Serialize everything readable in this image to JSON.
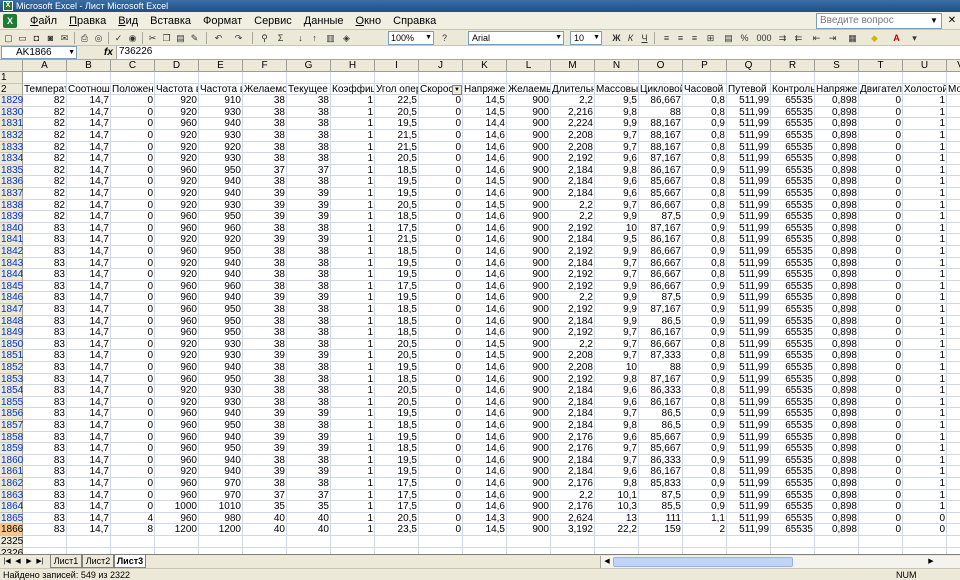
{
  "window": {
    "title": "Microsoft Excel - Лист Microsoft Excel"
  },
  "menu": {
    "items": [
      {
        "u": "Ф",
        "r": "айл"
      },
      {
        "u": "П",
        "r": "равка"
      },
      {
        "u": "В",
        "r": "ид"
      },
      {
        "u": "",
        "r": "Вставка"
      },
      {
        "u": "",
        "r": "Формат"
      },
      {
        "u": "",
        "r": "Сервис"
      },
      {
        "u": "Д",
        "r": "анные"
      },
      {
        "u": "О",
        "r": "кно"
      },
      {
        "u": "",
        "r": "Справка"
      }
    ],
    "help_placeholder": "Введите вопрос"
  },
  "toolbar": {
    "zoom": "100%",
    "font": "Arial",
    "font_size": "10",
    "bold": "Ж",
    "italic": "К",
    "underline": "Ч",
    "percent": "%",
    "thousands": "000"
  },
  "formula": {
    "namebox": "AK1866",
    "fx": "fx",
    "value": "736226"
  },
  "sheet": {
    "columns": [
      "A",
      "B",
      "C",
      "D",
      "E",
      "F",
      "G",
      "H",
      "I",
      "J",
      "K",
      "L",
      "M",
      "N",
      "O",
      "P",
      "Q",
      "R",
      "S",
      "T",
      "U",
      "V"
    ],
    "header_row_labels": [
      "1",
      "2"
    ],
    "headers": [
      "Температ",
      "Соотноше",
      "Положени",
      "Частота в",
      "Частота в",
      "Желаемое",
      "Текущее г",
      "Коэффици",
      "Угол опер",
      "Скорост",
      "Напряжен",
      "Желаемые",
      "Длительнс",
      "Массовый",
      "Цикловой",
      "Часовой р",
      "Путевой р",
      "Контрольн",
      "Напряжен",
      "Двигатель",
      "Холостой з",
      "Мощн"
    ],
    "rows": [
      {
        "n": "1829",
        "v": [
          "82",
          "14,7",
          "0",
          "920",
          "910",
          "38",
          "38",
          "1",
          "22,5",
          "0",
          "14,5",
          "900",
          "2,2",
          "9,5",
          "86,667",
          "0,8",
          "511,99",
          "65535",
          "0,898",
          "0",
          "1",
          ""
        ]
      },
      {
        "n": "1830",
        "v": [
          "82",
          "14,7",
          "0",
          "920",
          "930",
          "38",
          "38",
          "1",
          "20,5",
          "0",
          "14,5",
          "900",
          "2,216",
          "9,8",
          "88",
          "0,8",
          "511,99",
          "65535",
          "0,898",
          "0",
          "1",
          ""
        ]
      },
      {
        "n": "1831",
        "v": [
          "82",
          "14,7",
          "0",
          "960",
          "940",
          "38",
          "38",
          "1",
          "19,5",
          "0",
          "14,4",
          "900",
          "2,224",
          "9,9",
          "88,167",
          "0,9",
          "511,99",
          "65535",
          "0,898",
          "0",
          "1",
          ""
        ]
      },
      {
        "n": "1832",
        "v": [
          "82",
          "14,7",
          "0",
          "920",
          "930",
          "38",
          "38",
          "1",
          "21,5",
          "0",
          "14,6",
          "900",
          "2,208",
          "9,7",
          "88,167",
          "0,8",
          "511,99",
          "65535",
          "0,898",
          "0",
          "1",
          ""
        ]
      },
      {
        "n": "1833",
        "v": [
          "82",
          "14,7",
          "0",
          "920",
          "920",
          "38",
          "38",
          "1",
          "21,5",
          "0",
          "14,6",
          "900",
          "2,208",
          "9,7",
          "88,167",
          "0,8",
          "511,99",
          "65535",
          "0,898",
          "0",
          "1",
          ""
        ]
      },
      {
        "n": "1834",
        "v": [
          "82",
          "14,7",
          "0",
          "920",
          "930",
          "38",
          "38",
          "1",
          "20,5",
          "0",
          "14,6",
          "900",
          "2,192",
          "9,6",
          "87,167",
          "0,8",
          "511,99",
          "65535",
          "0,898",
          "0",
          "1",
          ""
        ]
      },
      {
        "n": "1835",
        "v": [
          "82",
          "14,7",
          "0",
          "960",
          "950",
          "37",
          "37",
          "1",
          "18,5",
          "0",
          "14,6",
          "900",
          "2,184",
          "9,8",
          "86,167",
          "0,9",
          "511,99",
          "65535",
          "0,898",
          "0",
          "1",
          ""
        ]
      },
      {
        "n": "1836",
        "v": [
          "82",
          "14,7",
          "0",
          "920",
          "940",
          "38",
          "38",
          "1",
          "19,5",
          "0",
          "14,5",
          "900",
          "2,184",
          "9,6",
          "85,667",
          "0,8",
          "511,99",
          "65535",
          "0,898",
          "0",
          "1",
          ""
        ]
      },
      {
        "n": "1837",
        "v": [
          "82",
          "14,7",
          "0",
          "920",
          "940",
          "39",
          "39",
          "1",
          "19,5",
          "0",
          "14,6",
          "900",
          "2,184",
          "9,6",
          "85,667",
          "0,8",
          "511,99",
          "65535",
          "0,898",
          "0",
          "1",
          ""
        ]
      },
      {
        "n": "1838",
        "v": [
          "82",
          "14,7",
          "0",
          "920",
          "930",
          "39",
          "39",
          "1",
          "20,5",
          "0",
          "14,5",
          "900",
          "2,2",
          "9,7",
          "86,667",
          "0,8",
          "511,99",
          "65535",
          "0,898",
          "0",
          "1",
          ""
        ]
      },
      {
        "n": "1839",
        "v": [
          "82",
          "14,7",
          "0",
          "960",
          "950",
          "39",
          "39",
          "1",
          "18,5",
          "0",
          "14,6",
          "900",
          "2,2",
          "9,9",
          "87,5",
          "0,9",
          "511,99",
          "65535",
          "0,898",
          "0",
          "1",
          ""
        ]
      },
      {
        "n": "1840",
        "v": [
          "83",
          "14,7",
          "0",
          "960",
          "960",
          "38",
          "38",
          "1",
          "17,5",
          "0",
          "14,6",
          "900",
          "2,192",
          "10",
          "87,167",
          "0,9",
          "511,99",
          "65535",
          "0,898",
          "0",
          "1",
          ""
        ]
      },
      {
        "n": "1841",
        "v": [
          "83",
          "14,7",
          "0",
          "920",
          "920",
          "39",
          "39",
          "1",
          "21,5",
          "0",
          "14,6",
          "900",
          "2,184",
          "9,5",
          "86,167",
          "0,8",
          "511,99",
          "65535",
          "0,898",
          "0",
          "1",
          ""
        ]
      },
      {
        "n": "1842",
        "v": [
          "83",
          "14,7",
          "0",
          "960",
          "950",
          "38",
          "38",
          "1",
          "18,5",
          "0",
          "14,6",
          "900",
          "2,192",
          "9,9",
          "86,667",
          "0,9",
          "511,99",
          "65535",
          "0,898",
          "0",
          "1",
          ""
        ]
      },
      {
        "n": "1843",
        "v": [
          "83",
          "14,7",
          "0",
          "920",
          "940",
          "38",
          "38",
          "1",
          "19,5",
          "0",
          "14,6",
          "900",
          "2,184",
          "9,7",
          "86,667",
          "0,8",
          "511,99",
          "65535",
          "0,898",
          "0",
          "1",
          ""
        ]
      },
      {
        "n": "1844",
        "v": [
          "83",
          "14,7",
          "0",
          "920",
          "940",
          "38",
          "38",
          "1",
          "19,5",
          "0",
          "14,6",
          "900",
          "2,192",
          "9,7",
          "86,667",
          "0,8",
          "511,99",
          "65535",
          "0,898",
          "0",
          "1",
          ""
        ]
      },
      {
        "n": "1845",
        "v": [
          "83",
          "14,7",
          "0",
          "960",
          "960",
          "38",
          "38",
          "1",
          "17,5",
          "0",
          "14,6",
          "900",
          "2,192",
          "9,9",
          "86,667",
          "0,9",
          "511,99",
          "65535",
          "0,898",
          "0",
          "1",
          ""
        ]
      },
      {
        "n": "1846",
        "v": [
          "83",
          "14,7",
          "0",
          "960",
          "940",
          "39",
          "39",
          "1",
          "19,5",
          "0",
          "14,6",
          "900",
          "2,2",
          "9,9",
          "87,5",
          "0,9",
          "511,99",
          "65535",
          "0,898",
          "0",
          "1",
          ""
        ]
      },
      {
        "n": "1847",
        "v": [
          "83",
          "14,7",
          "0",
          "960",
          "950",
          "38",
          "38",
          "1",
          "18,5",
          "0",
          "14,6",
          "900",
          "2,192",
          "9,9",
          "87,167",
          "0,9",
          "511,99",
          "65535",
          "0,898",
          "0",
          "1",
          ""
        ]
      },
      {
        "n": "1848",
        "v": [
          "83",
          "14,7",
          "0",
          "960",
          "950",
          "38",
          "38",
          "1",
          "18,5",
          "0",
          "14,6",
          "900",
          "2,184",
          "9,9",
          "86,5",
          "0,9",
          "511,99",
          "65535",
          "0,898",
          "0",
          "1",
          ""
        ]
      },
      {
        "n": "1849",
        "v": [
          "83",
          "14,7",
          "0",
          "960",
          "950",
          "38",
          "38",
          "1",
          "18,5",
          "0",
          "14,6",
          "900",
          "2,192",
          "9,7",
          "86,167",
          "0,9",
          "511,99",
          "65535",
          "0,898",
          "0",
          "1",
          ""
        ]
      },
      {
        "n": "1850",
        "v": [
          "83",
          "14,7",
          "0",
          "920",
          "930",
          "38",
          "38",
          "1",
          "20,5",
          "0",
          "14,5",
          "900",
          "2,2",
          "9,7",
          "86,667",
          "0,8",
          "511,99",
          "65535",
          "0,898",
          "0",
          "1",
          ""
        ]
      },
      {
        "n": "1851",
        "v": [
          "83",
          "14,7",
          "0",
          "920",
          "930",
          "39",
          "39",
          "1",
          "20,5",
          "0",
          "14,5",
          "900",
          "2,208",
          "9,7",
          "87,333",
          "0,8",
          "511,99",
          "65535",
          "0,898",
          "0",
          "1",
          ""
        ]
      },
      {
        "n": "1852",
        "v": [
          "83",
          "14,7",
          "0",
          "960",
          "940",
          "38",
          "38",
          "1",
          "19,5",
          "0",
          "14,6",
          "900",
          "2,208",
          "10",
          "88",
          "0,9",
          "511,99",
          "65535",
          "0,898",
          "0",
          "1",
          ""
        ]
      },
      {
        "n": "1853",
        "v": [
          "83",
          "14,7",
          "0",
          "960",
          "950",
          "38",
          "38",
          "1",
          "18,5",
          "0",
          "14,6",
          "900",
          "2,192",
          "9,8",
          "87,167",
          "0,9",
          "511,99",
          "65535",
          "0,898",
          "0",
          "1",
          ""
        ]
      },
      {
        "n": "1854",
        "v": [
          "83",
          "14,7",
          "0",
          "920",
          "930",
          "38",
          "38",
          "1",
          "20,5",
          "0",
          "14,6",
          "900",
          "2,184",
          "9,6",
          "86,333",
          "0,8",
          "511,99",
          "65535",
          "0,898",
          "0",
          "1",
          ""
        ]
      },
      {
        "n": "1855",
        "v": [
          "83",
          "14,7",
          "0",
          "920",
          "930",
          "38",
          "38",
          "1",
          "20,5",
          "0",
          "14,6",
          "900",
          "2,184",
          "9,6",
          "86,167",
          "0,8",
          "511,99",
          "65535",
          "0,898",
          "0",
          "1",
          ""
        ]
      },
      {
        "n": "1856",
        "v": [
          "83",
          "14,7",
          "0",
          "960",
          "940",
          "39",
          "39",
          "1",
          "19,5",
          "0",
          "14,6",
          "900",
          "2,184",
          "9,7",
          "86,5",
          "0,9",
          "511,99",
          "65535",
          "0,898",
          "0",
          "1",
          ""
        ]
      },
      {
        "n": "1857",
        "v": [
          "83",
          "14,7",
          "0",
          "960",
          "950",
          "38",
          "38",
          "1",
          "18,5",
          "0",
          "14,6",
          "900",
          "2,184",
          "9,8",
          "86,5",
          "0,9",
          "511,99",
          "65535",
          "0,898",
          "0",
          "1",
          ""
        ]
      },
      {
        "n": "1858",
        "v": [
          "83",
          "14,7",
          "0",
          "960",
          "940",
          "39",
          "39",
          "1",
          "19,5",
          "0",
          "14,6",
          "900",
          "2,176",
          "9,6",
          "85,667",
          "0,9",
          "511,99",
          "65535",
          "0,898",
          "0",
          "1",
          ""
        ]
      },
      {
        "n": "1859",
        "v": [
          "83",
          "14,7",
          "0",
          "960",
          "950",
          "39",
          "39",
          "1",
          "18,5",
          "0",
          "14,6",
          "900",
          "2,176",
          "9,7",
          "85,667",
          "0,9",
          "511,99",
          "65535",
          "0,898",
          "0",
          "1",
          ""
        ]
      },
      {
        "n": "1860",
        "v": [
          "83",
          "14,7",
          "0",
          "960",
          "940",
          "38",
          "38",
          "1",
          "19,5",
          "0",
          "14,6",
          "900",
          "2,184",
          "9,7",
          "86,333",
          "0,9",
          "511,99",
          "65535",
          "0,898",
          "0",
          "1",
          ""
        ]
      },
      {
        "n": "1861",
        "v": [
          "83",
          "14,7",
          "0",
          "920",
          "940",
          "39",
          "39",
          "1",
          "19,5",
          "0",
          "14,6",
          "900",
          "2,184",
          "9,6",
          "86,167",
          "0,8",
          "511,99",
          "65535",
          "0,898",
          "0",
          "1",
          ""
        ]
      },
      {
        "n": "1862",
        "v": [
          "83",
          "14,7",
          "0",
          "960",
          "970",
          "38",
          "38",
          "1",
          "17,5",
          "0",
          "14,6",
          "900",
          "2,176",
          "9,8",
          "85,833",
          "0,9",
          "511,99",
          "65535",
          "0,898",
          "0",
          "1",
          ""
        ]
      },
      {
        "n": "1863",
        "v": [
          "83",
          "14,7",
          "0",
          "960",
          "970",
          "37",
          "37",
          "1",
          "17,5",
          "0",
          "14,6",
          "900",
          "2,2",
          "10,1",
          "87,5",
          "0,9",
          "511,99",
          "65535",
          "0,898",
          "0",
          "1",
          ""
        ]
      },
      {
        "n": "1864",
        "v": [
          "83",
          "14,7",
          "0",
          "1000",
          "1010",
          "35",
          "35",
          "1",
          "17,5",
          "0",
          "14,6",
          "900",
          "2,176",
          "10,3",
          "85,5",
          "0,9",
          "511,99",
          "65535",
          "0,898",
          "0",
          "1",
          ""
        ]
      },
      {
        "n": "1865",
        "v": [
          "83",
          "14,7",
          "4",
          "960",
          "980",
          "40",
          "40",
          "1",
          "20,5",
          "0",
          "14,3",
          "900",
          "2,624",
          "13",
          "111",
          "1,1",
          "511,99",
          "65535",
          "0,898",
          "0",
          "0",
          ""
        ]
      },
      {
        "n": "1866",
        "v": [
          "83",
          "14,7",
          "8",
          "1200",
          "1200",
          "40",
          "40",
          "1",
          "23,5",
          "0",
          "14,5",
          "900",
          "3,192",
          "22,2",
          "159",
          "2",
          "511,99",
          "65535",
          "0,898",
          "0",
          "0",
          ""
        ]
      },
      {
        "n": "2325",
        "v": [
          "",
          "",
          "",
          "",
          "",
          "",
          "",
          "",
          "",
          "",
          "",
          "",
          "",
          "",
          "",
          "",
          "",
          "",
          "",
          "",
          "",
          ""
        ]
      },
      {
        "n": "2326",
        "v": [
          "",
          "",
          "",
          "",
          "",
          "",
          "",
          "",
          "",
          "",
          "",
          "",
          "",
          "",
          "",
          "",
          "",
          "",
          "",
          "",
          "",
          ""
        ]
      }
    ]
  },
  "tabs": {
    "items": [
      "Лист1",
      "Лист2",
      "Лист3"
    ]
  },
  "status": {
    "left": "Найдено записей: 549 из 2322",
    "num": "NUM"
  }
}
